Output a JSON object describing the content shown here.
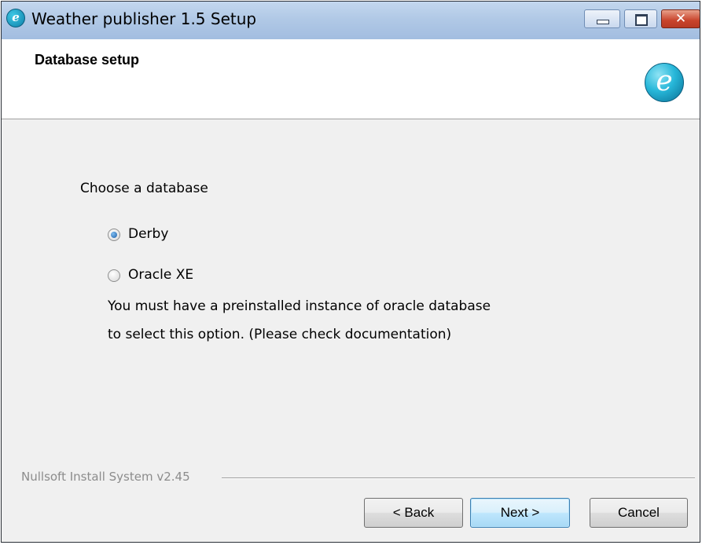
{
  "window": {
    "title": "Weather publisher 1.5 Setup",
    "app_icon_glyph": "e",
    "controls": {
      "minimize_icon": "minimize-icon",
      "maximize_icon": "maximize-icon",
      "close_glyph": "✕"
    }
  },
  "header": {
    "title": "Database setup",
    "logo_glyph": "e"
  },
  "content": {
    "prompt": "Choose a database",
    "options": [
      {
        "label": "Derby",
        "selected": true
      },
      {
        "label": "Oracle XE",
        "selected": false
      }
    ],
    "note_line1": "You must have a preinstalled instance of oracle database",
    "note_line2": "to select this option. (Please check documentation)"
  },
  "footer": {
    "branding": "Nullsoft Install System v2.45",
    "back_label": "< Back",
    "next_label": "Next >",
    "cancel_label": "Cancel"
  },
  "colors": {
    "titlebar": "#b1c9e6",
    "dialog_bg": "#f0f0f0",
    "header_bg": "#ffffff",
    "close_button": "#c8432b",
    "default_button_border": "#3c7fb1"
  }
}
